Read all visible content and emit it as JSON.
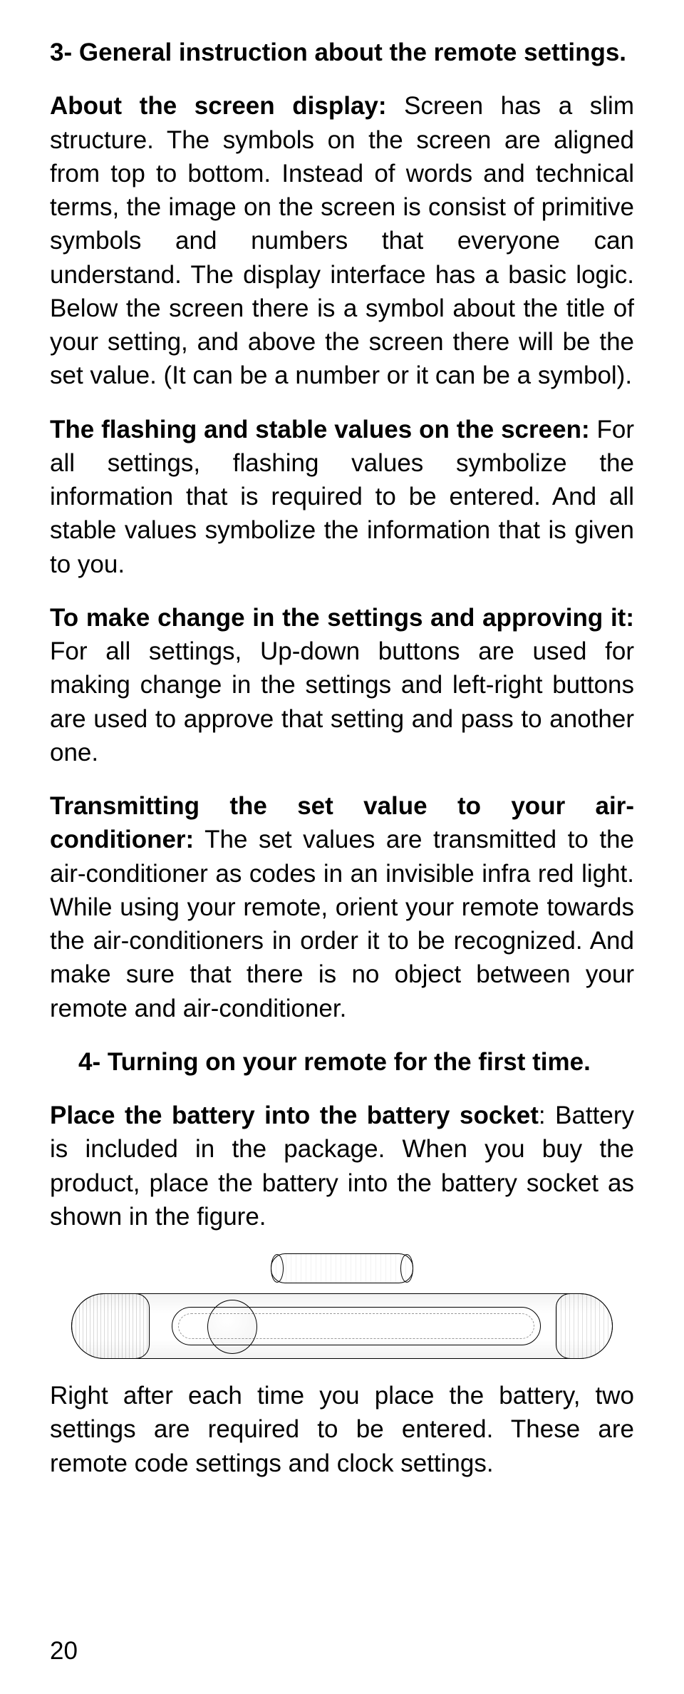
{
  "section3": {
    "heading": "3- General instruction about the remote settings.",
    "p1_lead": "About the screen display:",
    "p1_body": " Screen has a slim structure. The symbols on the screen are aligned from top to bottom. Instead of words and technical terms, the image on the screen is consist of primitive symbols and numbers that everyone can understand. The display interface has a basic logic. Below the screen there is a symbol about the title of your setting, and above the screen there will be the set value. (It can be a number or it can be a symbol).",
    "p2_lead": "The flashing and stable values on the screen:",
    "p2_body": " For all settings, flashing values symbolize the information that is required to be entered. And all stable values symbolize the information that is given to you.",
    "p3_lead": "To make change in the settings and approving it:",
    "p3_body": " For all settings, Up-down buttons are used for making change in the settings and left-right buttons are used to approve that setting and pass to another one.",
    "p4_lead": "Transmitting the set value to your air-conditioner:",
    "p4_body": " The set values are transmitted to the air-conditioner as codes in an invisible infra red light. While using your remote, orient your remote towards the air-conditioners in order it to be recognized. And make sure that there is no object between your remote and air-conditioner."
  },
  "section4": {
    "heading": "4- Turning on your remote for the first time.",
    "p1_lead": "Place the battery into the battery socket",
    "p1_body": ": Battery is included in the package. When you buy the product, place the battery into the battery socket as shown in the figure.",
    "p2": "Right after each time you place the battery, two settings are required to be entered. These are remote code settings and clock settings."
  },
  "page_number": "20"
}
